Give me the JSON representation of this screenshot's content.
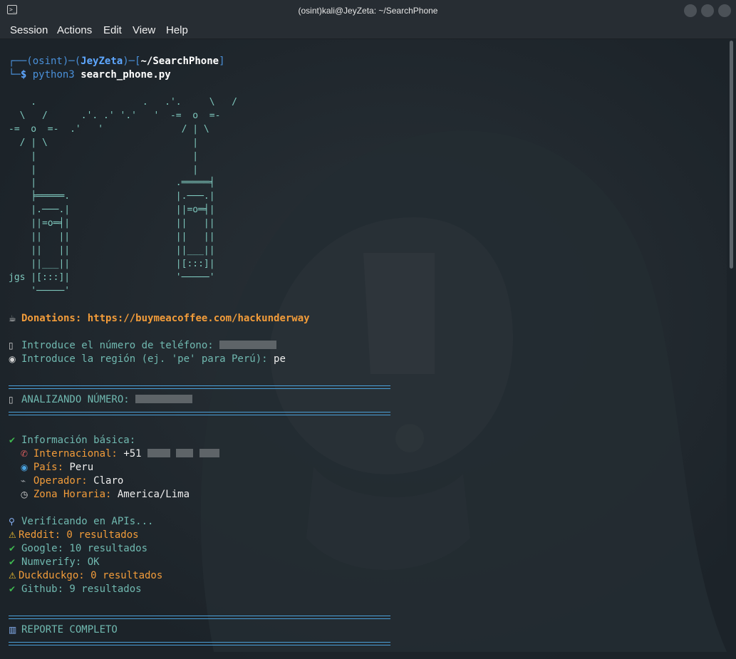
{
  "window": {
    "title": "(osint)kali@JeyZeta: ~/SearchPhone",
    "app_icon": "terminal-icon"
  },
  "menu": [
    "Session",
    "Actions",
    "Edit",
    "View",
    "Help"
  ],
  "prompt": {
    "env": "osint",
    "user_host": "JeyZeta",
    "cwd": "~/SearchPhone",
    "cmd_bin": "python3",
    "cmd_arg": "search_phone.py"
  },
  "ascii_art": "    .                   .   .'.     \\   /\n  \\   /      .'. .' '.'   '  -=  o  =-\n-=  o  =-  .'   '              / | \\\n  / | \\                          |\n    |                            |\n    |                            |\n    |                         .═════╡\n    ╞═════.                   |.───.|\n    |.───.|                   ||=o═╡|\n    ||=o═╡|                   ||   ||\n    ||   ||                   ||   ||\n    ||   ||                   ||___||\n    ||___||                   |[:::]|\njgs |[:::]|                   '─────'\n    '─────'",
  "donations": {
    "icon": "coffee-icon",
    "label": "Donations:",
    "url": "https://buymeacoffee.com/hackunderway"
  },
  "inputs": {
    "phone_prompt": "Introduce el número de teléfono:",
    "region_prompt": "Introduce la región (ej. 'pe' para Perú):",
    "region_value": "pe"
  },
  "analyzing_label": "ANALIZANDO NÚMERO:",
  "basic_info": {
    "heading": "Información básica:",
    "international_label": "Internacional:",
    "international_prefix": "+51",
    "country_label": "País:",
    "country_value": "Peru",
    "operator_label": "Operador:",
    "operator_value": "Claro",
    "timezone_label": "Zona Horaria:",
    "timezone_value": "America/Lima"
  },
  "api_check": {
    "heading": "Verificando en APIs...",
    "results": [
      {
        "status": "warning",
        "text": "Reddit: 0 resultados"
      },
      {
        "status": "ok",
        "text": "Google: 10 resultados"
      },
      {
        "status": "ok",
        "text": "Numverify: OK"
      },
      {
        "status": "warning",
        "text": "Duckduckgo: 0 resultados"
      },
      {
        "status": "ok",
        "text": "Github: 9 resultados"
      }
    ]
  },
  "report_label": "REPORTE COMPLETO",
  "colors": {
    "prompt_blue": "#4a90d9",
    "ascii_teal": "#7ec8bd",
    "warning_orange": "#f29c3a",
    "check_green": "#3fb950"
  }
}
